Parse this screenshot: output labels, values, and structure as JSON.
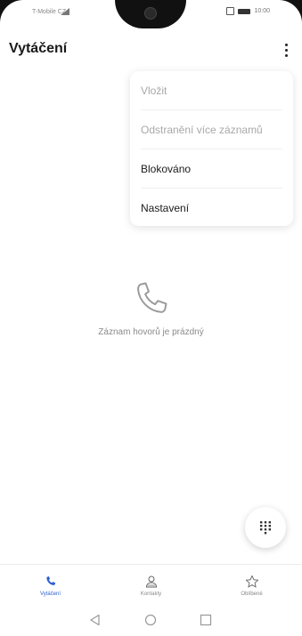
{
  "status_bar": {
    "carrier": "T-Mobile CZ",
    "time": "10:00"
  },
  "header": {
    "title": "Vytáčení",
    "overflow_icon": "more-vertical-icon"
  },
  "menu": {
    "items": [
      {
        "label": "Vložit",
        "enabled": false
      },
      {
        "label": "Odstranění více záznamů",
        "enabled": false
      },
      {
        "label": "Blokováno",
        "enabled": true
      },
      {
        "label": "Nastavení",
        "enabled": true
      }
    ]
  },
  "empty_state": {
    "icon": "phone-icon",
    "text": "Záznam hovorů je prázdný"
  },
  "fab": {
    "icon": "dialpad-icon"
  },
  "bottom_nav": {
    "items": [
      {
        "label": "Vytáčení",
        "icon": "phone-icon",
        "active": true
      },
      {
        "label": "Kontakty",
        "icon": "contacts-icon",
        "active": false
      },
      {
        "label": "Oblíbené",
        "icon": "star-icon",
        "active": false
      }
    ]
  },
  "system_nav": {
    "back": "back-icon",
    "home": "home-icon",
    "recents": "recents-icon"
  },
  "colors": {
    "accent": "#2f5fd0",
    "disabled_text": "#a8a8a8"
  }
}
